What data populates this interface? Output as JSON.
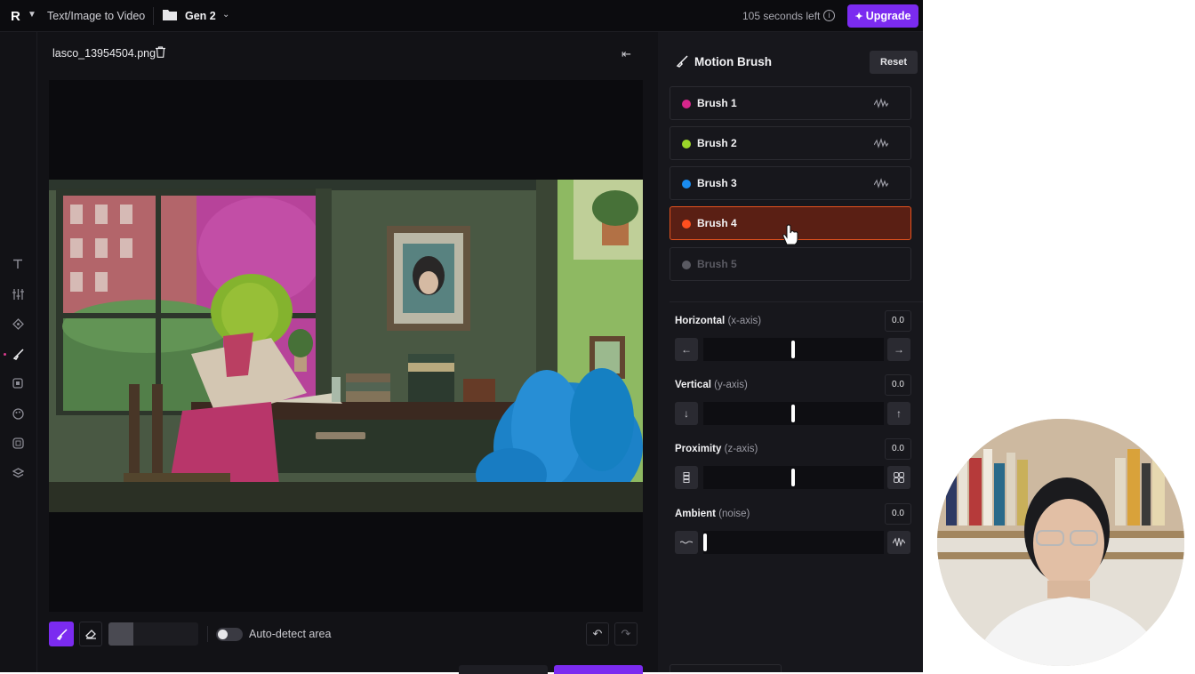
{
  "topbar": {
    "logo": "R",
    "title": "Text/Image to Video",
    "project": "Gen 2",
    "time_left": "105 seconds left",
    "upgrade_label": "Upgrade"
  },
  "editor": {
    "filename": "lasco_13954504.png",
    "auto_detect_label": "Auto-detect area",
    "auto_detect_on": false
  },
  "panel": {
    "title": "Motion Brush",
    "reset_label": "Reset",
    "brushes": [
      {
        "name": "Brush 1",
        "color": "#d6268c"
      },
      {
        "name": "Brush 2",
        "color": "#9bd62a"
      },
      {
        "name": "Brush 3",
        "color": "#1a8cf0"
      },
      {
        "name": "Brush 4",
        "color": "#ff4f1f"
      },
      {
        "name": "Brush 5",
        "color": "#5a5a62"
      }
    ],
    "selected_brush": "Brush 4",
    "controls": {
      "horizontal": {
        "label": "Horizontal",
        "sub": "(x-axis)",
        "value": "0.0"
      },
      "vertical": {
        "label": "Vertical",
        "sub": "(y-axis)",
        "value": "0.0"
      },
      "proximity": {
        "label": "Proximity",
        "sub": "(z-axis)",
        "value": "0.0"
      },
      "ambient": {
        "label": "Ambient",
        "sub": "(noise)",
        "value": "0.0"
      }
    }
  },
  "colors": {
    "accent": "#7b2bf0",
    "selected_brush_bg": "#5a1f14",
    "selected_brush_border": "#e5531f"
  }
}
